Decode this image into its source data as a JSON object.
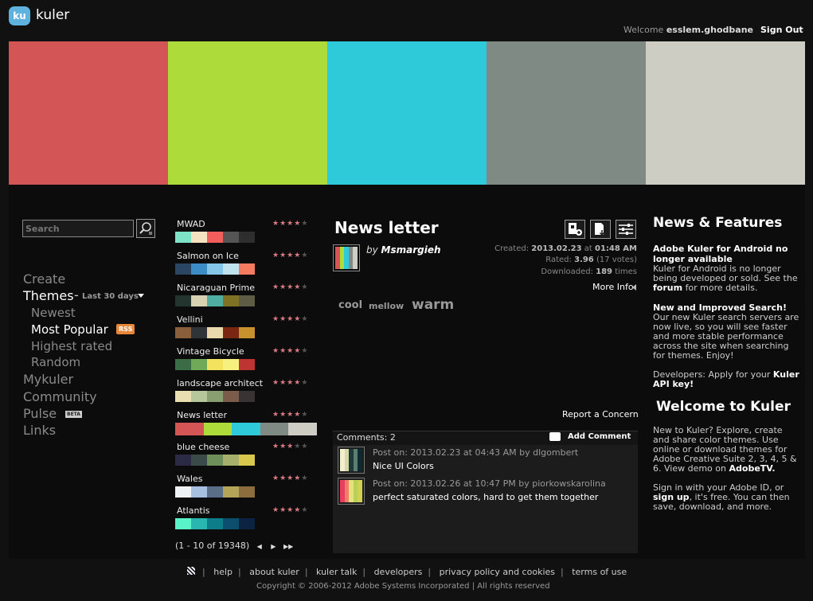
{
  "header": {
    "logo_badge": "ku",
    "brand": "kuler",
    "welcome_prefix": "Welcome",
    "username": "esslem.ghodbane",
    "sign_out": "Sign Out"
  },
  "banner_colors": [
    "#D45556",
    "#ACDB3A",
    "#2ECAD9",
    "#808A85",
    "#CECDC3"
  ],
  "search": {
    "placeholder": "Search"
  },
  "nav": {
    "create": "Create",
    "themes": "Themes",
    "dash": "-",
    "period": "Last 30 days",
    "newest": "Newest",
    "most_popular": "Most Popular",
    "rss": "RSS",
    "highest_rated": "Highest rated",
    "random": "Random",
    "mykuler": "Mykuler",
    "community": "Community",
    "pulse": "Pulse",
    "beta": "BETA",
    "links": "Links"
  },
  "themes": [
    {
      "name": "MWAD",
      "rating": 4,
      "colors": [
        "#7FE3C8",
        "#F4E2C0",
        "#F05F5B",
        "#555555",
        "#2E2E2E"
      ]
    },
    {
      "name": "Salmon on Ice",
      "rating": 4,
      "colors": [
        "#2A4663",
        "#3C8DC6",
        "#84C6E8",
        "#BFE4F0",
        "#F47B60"
      ]
    },
    {
      "name": "Nicaraguan Prime",
      "rating": 4,
      "colors": [
        "#243530",
        "#D8D1B2",
        "#4FADA2",
        "#807224",
        "#5E5C44"
      ]
    },
    {
      "name": "Vellini",
      "rating": 4,
      "colors": [
        "#8A5F3B",
        "#2E3437",
        "#EAD9AC",
        "#7A2612",
        "#C7922E"
      ]
    },
    {
      "name": "Vintage Bicycle",
      "rating": 4,
      "colors": [
        "#3C6C45",
        "#70A958",
        "#F2E25E",
        "#F6F07E",
        "#BE3433"
      ]
    },
    {
      "name": "landscape architect",
      "rating": 4,
      "colors": [
        "#EADFB0",
        "#B6C79B",
        "#889F72",
        "#7B5B4A",
        "#3A3334"
      ]
    },
    {
      "name": "News letter",
      "rating": 4,
      "colors": [
        "#D45556",
        "#ACDB3A",
        "#2ECAD9",
        "#808A85",
        "#CECDC3"
      ]
    },
    {
      "name": "blue cheese",
      "rating": 3,
      "colors": [
        "#2A2A44",
        "#3A4A48",
        "#6F8F5A",
        "#A7B06A",
        "#D8C84E"
      ]
    },
    {
      "name": "Wales",
      "rating": 4,
      "colors": [
        "#EEF2F4",
        "#A8C0E0",
        "#5A6E88",
        "#B4A458",
        "#8C6E3E"
      ]
    },
    {
      "name": "Atlantis",
      "rating": 4,
      "colors": [
        "#5AF2C8",
        "#2AB6B0",
        "#0E7D8A",
        "#0B4E6E",
        "#0A2442"
      ]
    }
  ],
  "pager": "(1 - 10 of 19348)",
  "detail": {
    "title": "News letter",
    "by_prefix": "by",
    "author": "Msmargieh",
    "created_label": "Created:",
    "created_date": "2013.02.23",
    "created_at": "at",
    "created_time": "01:48 AM",
    "rated_label": "Rated:",
    "rated_value": "3.96",
    "rated_votes": "(17 votes)",
    "downloaded_label": "Downloaded:",
    "downloaded_value": "189",
    "downloaded_suffix": "times",
    "more_info": "More Info",
    "tags": [
      "cool",
      "mellow",
      "warm"
    ],
    "report": "Report a Concern"
  },
  "comments": {
    "count_label": "Comments: 2",
    "add_label": "Add Comment",
    "items": [
      {
        "post": "Post on: 2013.02.23 at 04:43 AM by dlgombert",
        "text": "Nice UI Colors",
        "colors": [
          "#F2F0C8",
          "#D8D8A8",
          "#1E3A38",
          "#5C7E6E",
          "#0E2A2E"
        ]
      },
      {
        "post": "Post on: 2013.02.26 at 10:47 PM by piorkowskarolina",
        "text": "perfect saturated colors, hard to get them together",
        "colors": [
          "#E8405C",
          "#F07C6C",
          "#E8E07A",
          "#B4D25A",
          "#D4D050"
        ]
      }
    ]
  },
  "news": {
    "title": "News & Features",
    "item1_title": "Adobe Kuler for Android no longer available",
    "item1_body": "Kuler for Android is no longer being developed or sold. See the",
    "item1_link": "forum",
    "item1_tail": "for more details.",
    "item2_title": "New and Improved Search!",
    "item2_body": "Our new Kuler search servers are now live, so you will see faster and more stable performance across the site when searching for themes.  Enjoy!",
    "item3_body": "Developers: Apply for your",
    "item3_link": "Kuler API key!",
    "welcome_title": "Welcome to Kuler",
    "welcome_body": "New to Kuler? Explore, create and share color themes. Use online or download themes for Adobe Creative Suite 2, 3, 4, 5 & 6. View demo on",
    "welcome_link": "AdobeTV.",
    "signin_body": "Sign in with your Adobe ID, or",
    "signin_link": "sign up",
    "signin_tail": ", it's free. You can then save, download, and more."
  },
  "footer": {
    "links": [
      "help",
      "about kuler",
      "kuler talk",
      "developers",
      "privacy policy and cookies",
      "terms of use"
    ],
    "copyright": "Copyright © 2006-2012 Adobe Systems Incorporated | All rights reserved"
  }
}
